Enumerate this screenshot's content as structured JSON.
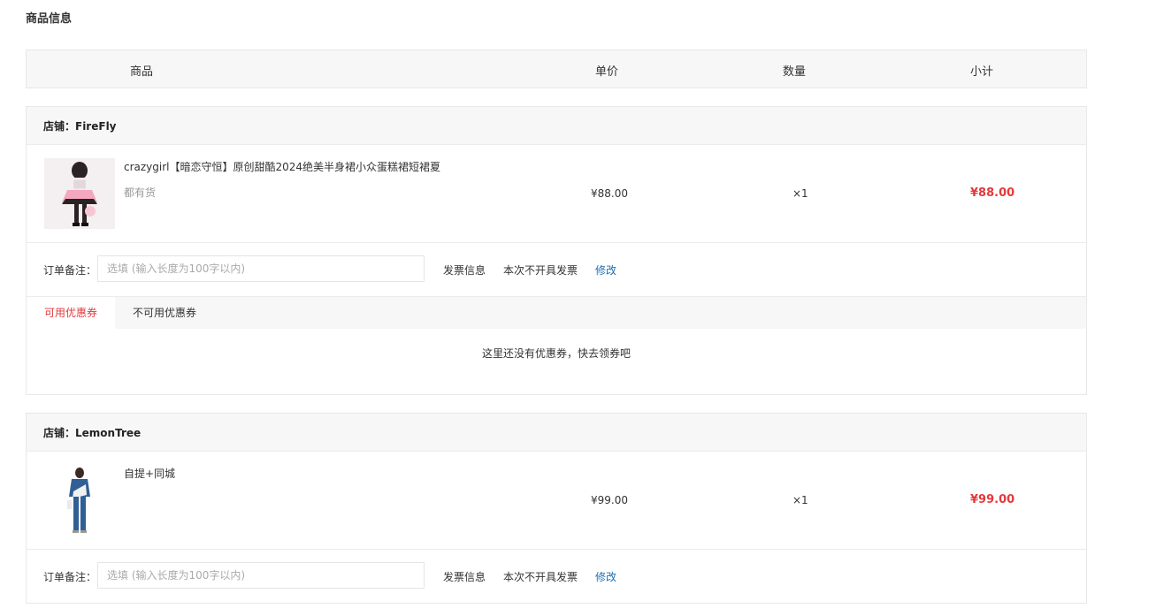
{
  "page": {
    "title": "商品信息"
  },
  "table_head": {
    "product": "商品",
    "unit_price": "单价",
    "quantity": "数量",
    "subtotal": "小计"
  },
  "shops": [
    {
      "label": "店铺：FireFly",
      "product": {
        "title": "crazygirl【暗恋守恒】原创甜酷2024绝美半身裙小众蛋糕裙短裙夏",
        "subtitle": "都有货",
        "price": "¥88.00",
        "qty": "×1",
        "subtotal": "¥88.00"
      },
      "remark": {
        "label": "订单备注：",
        "placeholder": "选填 (输入长度为100字以内)"
      },
      "invoice": {
        "label": "发票信息",
        "value": "本次不开具发票",
        "edit": "修改"
      },
      "coupon": {
        "tab_available": "可用优惠券",
        "tab_unavailable": "不可用优惠券",
        "empty": "这里还没有优惠券，快去领券吧"
      }
    },
    {
      "label": "店铺：LemonTree",
      "product": {
        "title": "自提+同城",
        "price": "¥99.00",
        "qty": "×1",
        "subtotal": "¥99.00"
      },
      "remark": {
        "label": "订单备注：",
        "placeholder": "选填 (输入长度为100字以内)"
      },
      "invoice": {
        "label": "发票信息",
        "value": "本次不开具发票",
        "edit": "修改"
      }
    }
  ],
  "colors": {
    "price_red": "#e4393c",
    "link_blue": "#1f6fb2",
    "header_bg": "#f7f7f7",
    "border": "#e8e8e8"
  },
  "icons": {
    "product1": "product-thumbnail-skirt",
    "product2": "product-thumbnail-outfit"
  }
}
